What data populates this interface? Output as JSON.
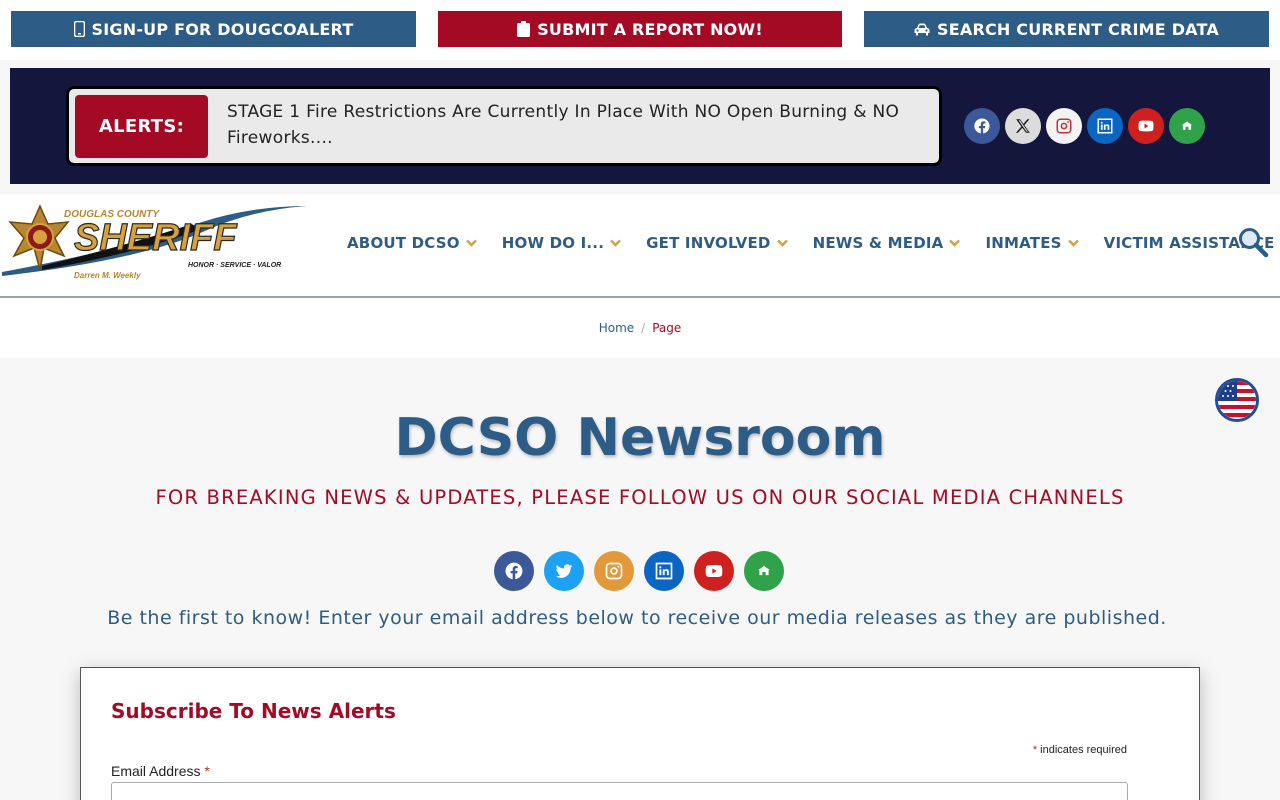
{
  "topbar": {
    "signup_label": "SIGN-UP FOR DOUGCOALERT",
    "report_label": "SUBMIT A REPORT NOW!",
    "crime_label": "SEARCH CURRENT CRIME DATA"
  },
  "alert": {
    "label": "ALERTS:",
    "text": "STAGE 1 Fire Restrictions Are Currently In Place With NO Open Burning & NO Fireworks...."
  },
  "logo": {
    "county": "DOUGLAS COUNTY",
    "word": "SHERIFF",
    "motto": "HONOR · SERVICE · VALOR",
    "name": "Darren M. Weekly"
  },
  "nav": {
    "items": [
      {
        "label": "ABOUT DCSO",
        "dropdown": true
      },
      {
        "label": "HOW DO I...",
        "dropdown": true
      },
      {
        "label": "GET INVOLVED",
        "dropdown": true
      },
      {
        "label": "NEWS & MEDIA",
        "dropdown": true
      },
      {
        "label": "INMATES",
        "dropdown": true
      },
      {
        "label": "VICTIM ASSISTANCE",
        "dropdown": false
      }
    ]
  },
  "breadcrumb": {
    "home": "Home",
    "separator": "/",
    "current": "Page"
  },
  "main": {
    "title": "DCSO Newsroom",
    "subtitle": "FOR BREAKING NEWS & UPDATES, PLEASE FOLLOW US ON OUR SOCIAL MEDIA CHANNELS",
    "intro": "Be the first to know! Enter your email address below to receive our media releases as they are published."
  },
  "form": {
    "title": "Subscribe To News Alerts",
    "required_star": "*",
    "required_note": "indicates required",
    "email_label": "Email Address",
    "email_value": ""
  },
  "icons": {
    "top_social": [
      "facebook-icon",
      "x-icon",
      "instagram-icon",
      "linkedin-icon",
      "youtube-icon",
      "nextdoor-icon"
    ],
    "mid_social": [
      "facebook-icon",
      "twitter-icon",
      "instagram-icon",
      "linkedin-icon",
      "youtube-icon",
      "nextdoor-icon"
    ],
    "language": "us-flag-icon",
    "search": "search-icon"
  },
  "colors": {
    "brand_blue": "#2d5c86",
    "brand_red": "#a50a25",
    "alert_band": "#15163e",
    "gold": "#d8a13a"
  }
}
